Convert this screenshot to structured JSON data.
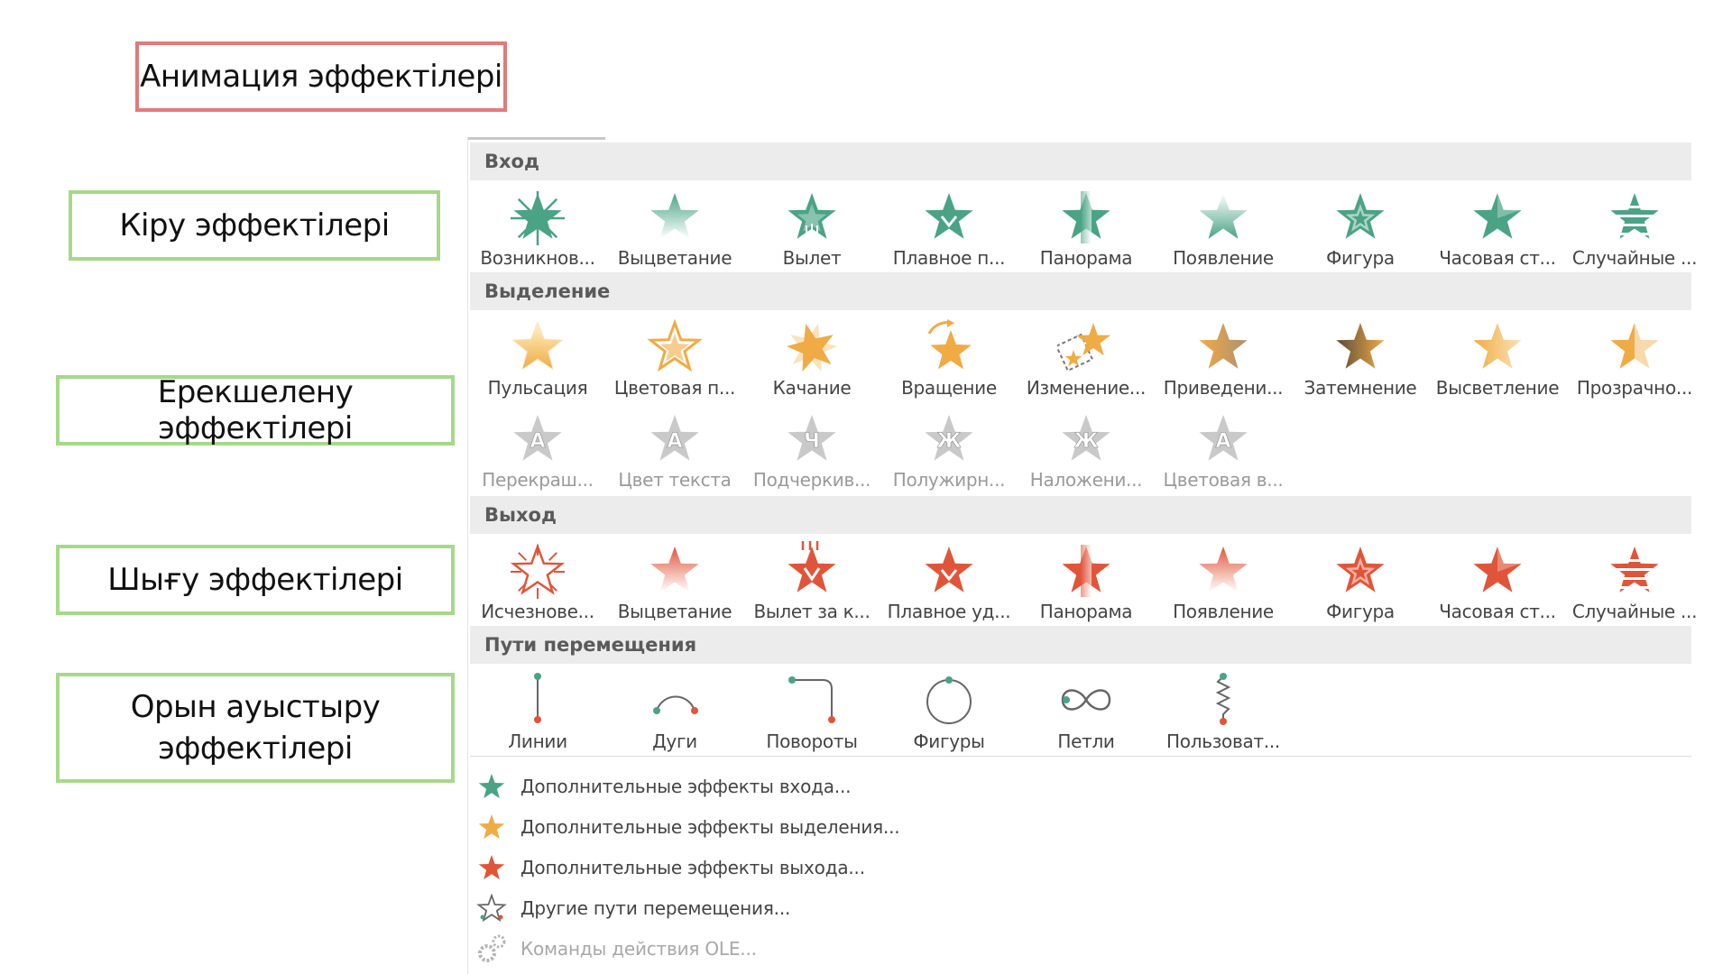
{
  "labels": {
    "title": "Анимация эффектілері",
    "entry": "Кіру эффектілері",
    "emphasis": "Ерекшелену эффектілері",
    "exit": "Шығу эффектілері",
    "motion": "Орын ауыстыру эффектілері"
  },
  "colors": {
    "title_border": "#e27a7a",
    "label_border": "#a6d98a",
    "entry": "#4aa384",
    "emphasis": "#f0ab45",
    "exit": "#e0553a",
    "dimmed": "#b7b7b7",
    "path": "#555555"
  },
  "sections": {
    "entry": {
      "title": "Вход",
      "items": [
        {
          "label": "Возникнов...",
          "icon": "star-burst-icon"
        },
        {
          "label": "Выцветание",
          "icon": "star-fade-icon"
        },
        {
          "label": "Вылет",
          "icon": "star-fly-in-icon"
        },
        {
          "label": "Плавное п...",
          "icon": "star-float-in-icon"
        },
        {
          "label": "Панорама",
          "icon": "star-split-icon"
        },
        {
          "label": "Появление",
          "icon": "star-wipe-icon"
        },
        {
          "label": "Фигура",
          "icon": "star-shape-icon"
        },
        {
          "label": "Часовая ст...",
          "icon": "star-wheel-icon"
        },
        {
          "label": "Случайные ...",
          "icon": "star-random-bars-icon"
        }
      ]
    },
    "emphasis": {
      "title": "Выделение",
      "items": [
        {
          "label": "Пульсация",
          "icon": "star-pulse-icon"
        },
        {
          "label": "Цветовая п...",
          "icon": "star-color-pulse-icon"
        },
        {
          "label": "Качание",
          "icon": "star-teeter-icon"
        },
        {
          "label": "Вращение",
          "icon": "star-spin-icon"
        },
        {
          "label": "Изменение...",
          "icon": "star-grow-shrink-icon"
        },
        {
          "label": "Приведени...",
          "icon": "star-desaturate-icon"
        },
        {
          "label": "Затемнение",
          "icon": "star-darken-icon"
        },
        {
          "label": "Высветление",
          "icon": "star-lighten-icon"
        },
        {
          "label": "Прозрачно...",
          "icon": "star-transparency-icon"
        }
      ],
      "text_items": [
        {
          "label": "Перекраш...",
          "glyph": "A"
        },
        {
          "label": "Цвет текста",
          "glyph": "A"
        },
        {
          "label": "Подчеркив...",
          "glyph": "Ч"
        },
        {
          "label": "Полужирн...",
          "glyph": "Ж"
        },
        {
          "label": "Наложени...",
          "glyph": "Ж"
        },
        {
          "label": "Цветовая в...",
          "glyph": "A"
        }
      ]
    },
    "exit": {
      "title": "Выход",
      "items": [
        {
          "label": "Исчезнове...",
          "icon": "star-disappear-icon"
        },
        {
          "label": "Выцветание",
          "icon": "star-fade-out-icon"
        },
        {
          "label": "Вылет за к...",
          "icon": "star-fly-out-icon"
        },
        {
          "label": "Плавное уд...",
          "icon": "star-float-out-icon"
        },
        {
          "label": "Панорама",
          "icon": "star-split-out-icon"
        },
        {
          "label": "Появление",
          "icon": "star-wipe-out-icon"
        },
        {
          "label": "Фигура",
          "icon": "star-shape-out-icon"
        },
        {
          "label": "Часовая ст...",
          "icon": "star-wheel-out-icon"
        },
        {
          "label": "Случайные ...",
          "icon": "star-random-bars-out-icon"
        }
      ]
    },
    "motion": {
      "title": "Пути перемещения",
      "items": [
        {
          "label": "Линии",
          "icon": "path-line-icon"
        },
        {
          "label": "Дуги",
          "icon": "path-arc-icon"
        },
        {
          "label": "Повороты",
          "icon": "path-turn-icon"
        },
        {
          "label": "Фигуры",
          "icon": "path-circle-icon"
        },
        {
          "label": "Петли",
          "icon": "path-loop-icon"
        },
        {
          "label": "Пользоват...",
          "icon": "path-custom-icon"
        }
      ]
    }
  },
  "commands": [
    {
      "label": "Дополнительные эффекты входа...",
      "icon": "green-star-icon"
    },
    {
      "label": "Дополнительные эффекты выделения...",
      "icon": "gold-star-icon"
    },
    {
      "label": "Дополнительные эффекты выхода...",
      "icon": "red-star-icon"
    },
    {
      "label": "Другие пути перемещения...",
      "icon": "outline-star-icon"
    },
    {
      "label": "Команды действия OLE...",
      "icon": "gears-icon",
      "disabled": true
    }
  ]
}
